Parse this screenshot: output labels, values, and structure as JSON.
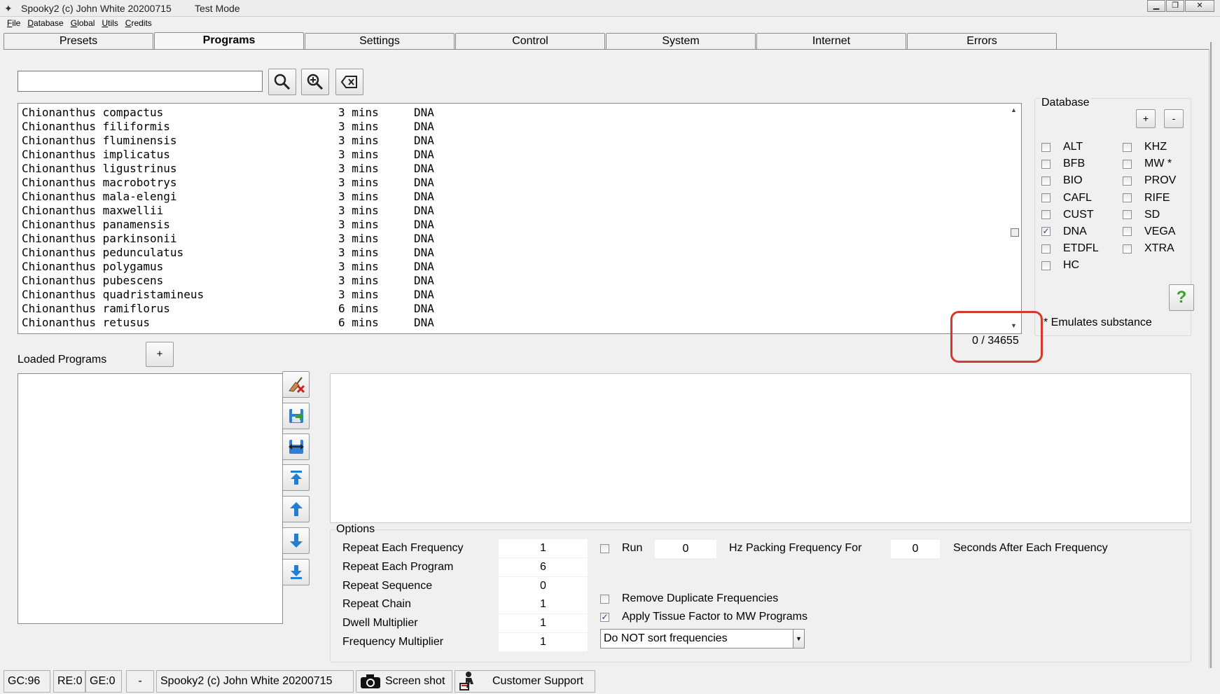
{
  "window": {
    "title": "Spooky2 (c) John White 20200715",
    "mode": "Test Mode",
    "buttons": {
      "minimize": "▁",
      "maximize": "❐",
      "close": "✕"
    }
  },
  "menu": [
    "File",
    "Database",
    "Global",
    "Utils",
    "Credits"
  ],
  "tabs": [
    "Presets",
    "Programs",
    "Settings",
    "Control",
    "System",
    "Internet",
    "Errors"
  ],
  "active_tab": "Programs",
  "search": {
    "value": "",
    "placeholder": ""
  },
  "search_buttons": [
    "search-icon",
    "zoom-in-icon",
    "clear-icon"
  ],
  "programs": [
    {
      "name": "Chionanthus compactus",
      "duration": "3 mins",
      "db": "DNA"
    },
    {
      "name": "Chionanthus filiformis",
      "duration": "3 mins",
      "db": "DNA"
    },
    {
      "name": "Chionanthus fluminensis",
      "duration": "3 mins",
      "db": "DNA"
    },
    {
      "name": "Chionanthus implicatus",
      "duration": "3 mins",
      "db": "DNA"
    },
    {
      "name": "Chionanthus ligustrinus",
      "duration": "3 mins",
      "db": "DNA"
    },
    {
      "name": "Chionanthus macrobotrys",
      "duration": "3 mins",
      "db": "DNA"
    },
    {
      "name": "Chionanthus mala-elengi",
      "duration": "3 mins",
      "db": "DNA"
    },
    {
      "name": "Chionanthus maxwellii",
      "duration": "3 mins",
      "db": "DNA"
    },
    {
      "name": "Chionanthus panamensis",
      "duration": "3 mins",
      "db": "DNA"
    },
    {
      "name": "Chionanthus parkinsonii",
      "duration": "3 mins",
      "db": "DNA"
    },
    {
      "name": "Chionanthus pedunculatus",
      "duration": "3 mins",
      "db": "DNA"
    },
    {
      "name": "Chionanthus polygamus",
      "duration": "3 mins",
      "db": "DNA"
    },
    {
      "name": "Chionanthus pubescens",
      "duration": "3 mins",
      "db": "DNA"
    },
    {
      "name": "Chionanthus quadristamineus",
      "duration": "3 mins",
      "db": "DNA"
    },
    {
      "name": "Chionanthus ramiflorus",
      "duration": "6 mins",
      "db": "DNA"
    },
    {
      "name": "Chionanthus retusus",
      "duration": "6 mins",
      "db": "DNA"
    }
  ],
  "database": {
    "label": "Database",
    "add_label": "+",
    "remove_label": "-",
    "left": [
      {
        "name": "ALT",
        "checked": false
      },
      {
        "name": "BFB",
        "checked": false
      },
      {
        "name": "BIO",
        "checked": false
      },
      {
        "name": "CAFL",
        "checked": false
      },
      {
        "name": "CUST",
        "checked": false
      },
      {
        "name": "DNA",
        "checked": true
      },
      {
        "name": "ETDFL",
        "checked": false
      },
      {
        "name": "HC",
        "checked": false
      }
    ],
    "right": [
      {
        "name": "KHZ",
        "checked": false
      },
      {
        "name": "MW *",
        "checked": false
      },
      {
        "name": "PROV",
        "checked": false
      },
      {
        "name": "RIFE",
        "checked": false
      },
      {
        "name": "SD",
        "checked": false
      },
      {
        "name": "VEGA",
        "checked": false
      },
      {
        "name": "XTRA",
        "checked": false
      }
    ],
    "help_label": "?",
    "emulates": "* Emulates substance"
  },
  "count": "0 / 34655",
  "loaded": {
    "label": "Loaded Programs",
    "add_label": "+"
  },
  "side_buttons": [
    "erase-icon",
    "save-icon",
    "swap-icon",
    "move-top-icon",
    "move-up-icon",
    "move-down-icon",
    "move-bottom-icon"
  ],
  "options": {
    "label": "Options",
    "rows": [
      {
        "label": "Repeat Each Frequency",
        "value": "1"
      },
      {
        "label": "Repeat Each Program",
        "value": "6"
      },
      {
        "label": "Repeat Sequence",
        "value": "0"
      },
      {
        "label": "Repeat Chain",
        "value": "1"
      },
      {
        "label": "Dwell Multiplier",
        "value": "1"
      },
      {
        "label": "Frequency Multiplier",
        "value": "1"
      }
    ],
    "run_label": "Run",
    "run_checked": false,
    "run_value": "0",
    "hz_label": "Hz Packing Frequency For",
    "seconds_value": "0",
    "seconds_label": "Seconds After Each Frequency",
    "remove_duplicates": {
      "label": "Remove Duplicate Frequencies",
      "checked": false
    },
    "apply_tissue": {
      "label": "Apply Tissue Factor to MW Programs",
      "checked": true
    },
    "sort": "Do NOT sort frequencies"
  },
  "status": {
    "gc": "GC:96",
    "re": "RE:0",
    "ge": "GE:0",
    "dash": "-",
    "copyright": "Spooky2 (c) John White 20200715",
    "screenshot": "Screen shot",
    "support": "Customer Support"
  }
}
